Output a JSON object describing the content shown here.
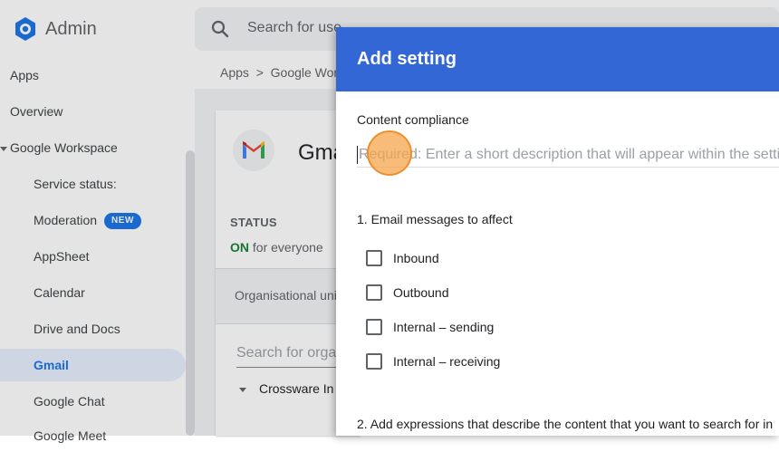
{
  "app": {
    "title": "Admin"
  },
  "search": {
    "placeholder": "Search for use"
  },
  "breadcrumb": {
    "text": "Apps  >  Google Wor"
  },
  "sidebar": {
    "items": [
      {
        "label": "Apps"
      },
      {
        "label": "Overview"
      },
      {
        "label": "Google Workspace"
      },
      {
        "label": "Service status:"
      },
      {
        "label": "Moderation",
        "badge": "NEW"
      },
      {
        "label": "AppSheet"
      },
      {
        "label": "Calendar"
      },
      {
        "label": "Drive and Docs"
      },
      {
        "label": "Gmail"
      },
      {
        "label": "Google Chat"
      },
      {
        "label": "Google Meet"
      }
    ]
  },
  "main": {
    "app_title": "Gma",
    "status_label": "STATUS",
    "status_on": "ON",
    "status_rest": "for everyone",
    "ou_label": "Organisational uni",
    "org_search_placeholder": "Search for orga",
    "org_item": "Crossware In"
  },
  "dialog": {
    "title": "Add setting",
    "field_label": "Content compliance",
    "description_placeholder": "Required: Enter a short description that will appear within the setting",
    "section1": "1. Email messages to affect",
    "checkboxes": [
      {
        "label": "Inbound",
        "checked": false
      },
      {
        "label": "Outbound",
        "checked": false
      },
      {
        "label": "Internal – sending",
        "checked": false
      },
      {
        "label": "Internal – receiving",
        "checked": false
      }
    ],
    "section2": "2. Add expressions that describe the content that you want to search for in"
  },
  "colors": {
    "header": "#3367d6",
    "accent": "#1a73e8",
    "status_on": "#188038"
  }
}
